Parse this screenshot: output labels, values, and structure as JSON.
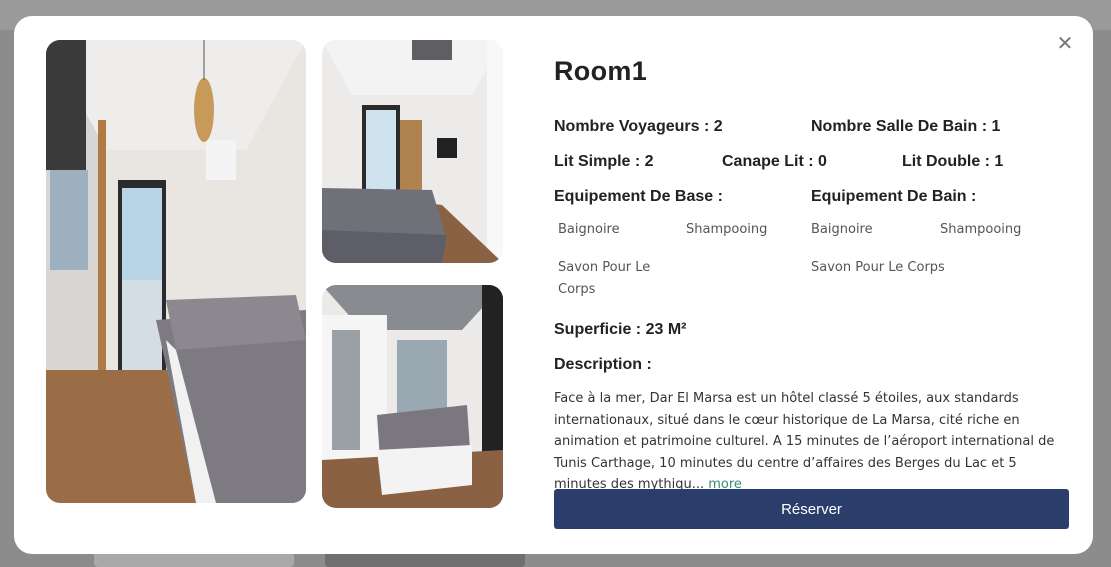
{
  "modal": {
    "close_icon": "close-icon",
    "title": "Room1",
    "stats": {
      "voyageurs": "Nombre Voyageurs : 2",
      "salle_bain": "Nombre Salle De Bain : 1",
      "lit_simple": "Lit Simple : 2",
      "canape_lit": "Canape Lit : 0",
      "lit_double": "Lit Double : 1"
    },
    "equipement_base": {
      "heading": "Equipement De Base :",
      "items": [
        "Baignoire",
        "Shampooing",
        "Savon Pour Le Corps"
      ]
    },
    "equipement_bain": {
      "heading": "Equipement De Bain :",
      "items": [
        "Baignoire",
        "Shampooing",
        "Savon Pour Le Corps"
      ]
    },
    "superficie": "Superficie : 23 M²",
    "description_heading": "Description :",
    "description": "Face à la mer, Dar El Marsa est un hôtel classé 5 étoiles, aux standards internationaux, situé dans le cœur historique de La Marsa, cité riche en animation et patrimoine culturel. A 15 minutes de l’aéroport international de Tunis Carthage, 10 minutes du centre d’affaires des Berges du Lac et 5 minutes des mythiqu...",
    "more_link": "more",
    "reserve_button": "Réserver"
  },
  "colors": {
    "button": "#2a3d6b",
    "more_link": "#3c8a6f"
  }
}
